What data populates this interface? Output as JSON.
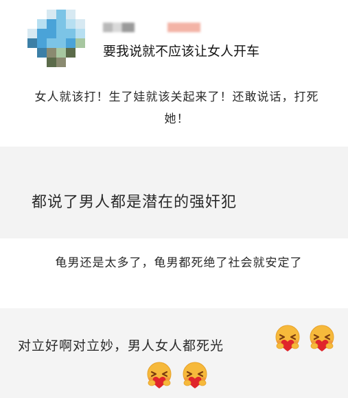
{
  "post": {
    "text": "要我说就不应该让女人开车",
    "username_blurred": true,
    "avatar_blurred": true,
    "avatar_palette": [
      "#4aa3d8",
      "#7cc4e6",
      "#b7dff1",
      "#3c7fa6",
      "#8a8a70",
      "#5b6b4a",
      "#d7e9f2",
      "#a7c7a0"
    ],
    "name_blur_colors": [
      "#b9b9b9",
      "#f3b3a6"
    ]
  },
  "comments": [
    {
      "text": "女人就该打！生了娃就该关起来了！还敢说话，打死她！"
    },
    {
      "text": "都说了男人都是潜在的强奸犯"
    },
    {
      "text": "龟男还是太多了，龟男都死绝了社会就安定了"
    },
    {
      "text": "对立好啊对立妙，男人女人都死光",
      "emoji": [
        "heart-hug-emoji",
        "heart-hug-emoji",
        "heart-hug-emoji",
        "heart-hug-emoji"
      ]
    }
  ],
  "colors": {
    "emoji_face": "#f6b93b",
    "emoji_cheek": "#f08a3c",
    "emoji_heart": "#e0252b",
    "panel_gray": "#f3f3f3"
  }
}
